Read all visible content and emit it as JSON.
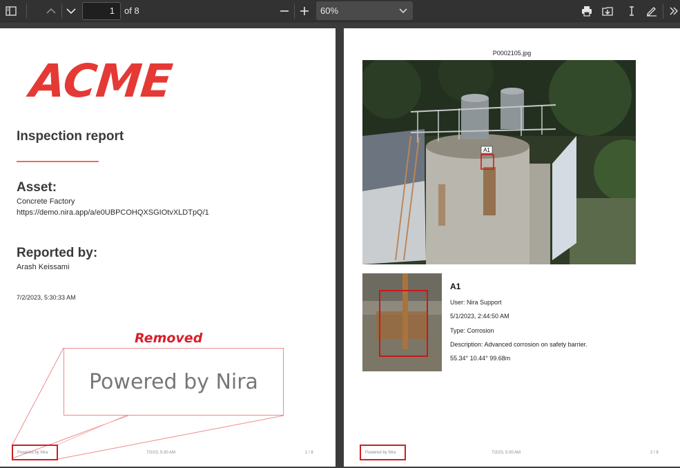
{
  "toolbar": {
    "page_current": "1",
    "page_total": "of 8",
    "zoom": "60%",
    "icons": [
      "sidebar-icon",
      "page-up-icon",
      "page-down-icon",
      "zoom-out-icon",
      "zoom-in-icon",
      "print-icon",
      "download-icon",
      "text-cursor-icon",
      "pen-icon",
      "more-icon"
    ]
  },
  "page1": {
    "logo": "ACME",
    "title": "Inspection report",
    "asset_heading": "Asset:",
    "asset_name": "Concrete Factory",
    "asset_url": "https://demo.nira.app/a/e0UBPCOHQXSGIOtvXLDTpQ/1",
    "reported_heading": "Reported by:",
    "reporter": "Arash Keissami",
    "timestamp": "7/2/2023, 5:30:33 AM",
    "removed_label": "Removed",
    "powered_zoom": "Powered by Nira",
    "footer_powered": "Powered by Nira",
    "footer_date": "7/2/23, 5:30 AM",
    "footer_page": "1 / 8"
  },
  "page2": {
    "image_name": "P0002105.jpg",
    "marker_label": "A1",
    "annotation_title": "A1",
    "user": "User: Nira Support",
    "date": "5/1/2023, 2:44:50 AM",
    "type": "Type: Corrosion",
    "description": "Description: Advanced corrosion on safety barrier.",
    "coords": "55.34° 10.44° 99.68m",
    "footer_powered": "Powered by Nira",
    "footer_date": "7/2/23, 5:30 AM",
    "footer_page": "2 / 8"
  },
  "colors": {
    "accent_red": "#e53935",
    "highlight_red": "#cc1f1f",
    "toolbar": "#323232"
  }
}
